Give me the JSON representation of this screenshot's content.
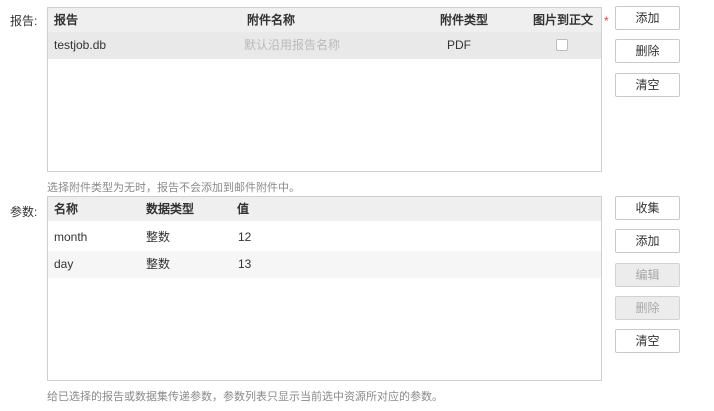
{
  "report_section": {
    "label": "报告:",
    "required_mark": "*",
    "columns": [
      "报告",
      "附件名称",
      "附件类型",
      "图片到正文"
    ],
    "rows": [
      {
        "report": "testjob.db",
        "attachment_name_placeholder": "默认沿用报告名称",
        "attachment_type": "PDF",
        "image_to_body_checked": false
      }
    ],
    "buttons": {
      "add": "添加",
      "delete": "删除",
      "clear": "清空"
    },
    "hint": "选择附件类型为无时，报告不会添加到邮件附件中。"
  },
  "param_section": {
    "label": "参数:",
    "columns": [
      "名称",
      "数据类型",
      "值"
    ],
    "rows": [
      {
        "name": "month",
        "type": "整数",
        "value": "12"
      },
      {
        "name": "day",
        "type": "整数",
        "value": "13"
      }
    ],
    "buttons": {
      "collect": "收集",
      "add": "添加",
      "edit": "编辑",
      "delete": "删除",
      "clear": "清空"
    },
    "hint": "给已选择的报告或数据集传递参数，参数列表只显示当前选中资源所对应的参数。"
  },
  "colors": {
    "header_bg": "#efefef",
    "selected_row_bg": "#e9e9e9",
    "required": "#e0443e"
  }
}
